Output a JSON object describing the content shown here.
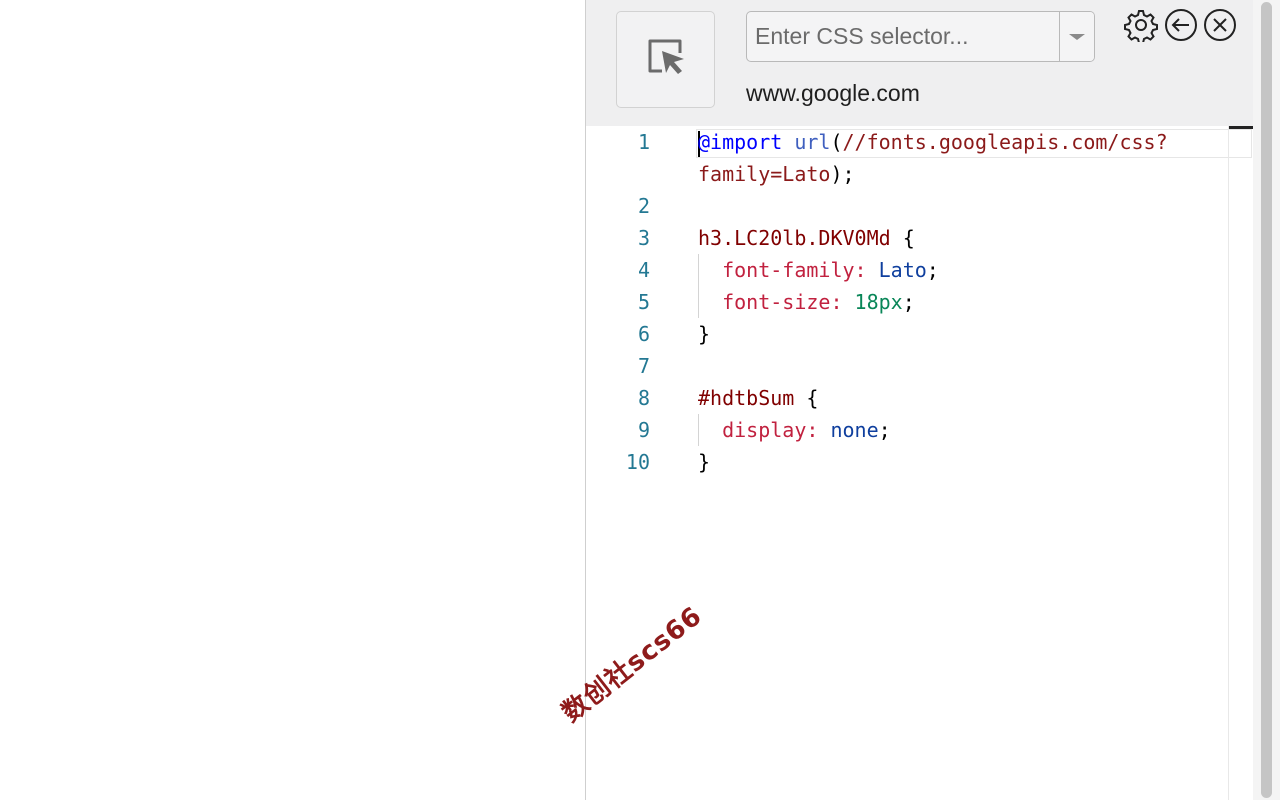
{
  "header": {
    "selector_placeholder": "Enter CSS selector...",
    "domain": "www.google.com",
    "icons": [
      "cursor-select-icon",
      "gear-icon",
      "back-arrow-icon",
      "close-icon"
    ]
  },
  "editor": {
    "lines": [
      {
        "num": "1",
        "tokens": [
          {
            "t": "@import",
            "c": "t-atrule"
          },
          {
            "t": " ",
            "c": "t-plain"
          },
          {
            "t": "url",
            "c": "t-func"
          },
          {
            "t": "(",
            "c": "t-plain"
          },
          {
            "t": "//fonts.googleapis.com/css?",
            "c": "t-url"
          }
        ]
      },
      {
        "num": "",
        "tokens": [
          {
            "t": "family=Lato",
            "c": "t-url"
          },
          {
            "t": ");",
            "c": "t-plain"
          }
        ]
      },
      {
        "num": "2",
        "tokens": []
      },
      {
        "num": "3",
        "tokens": [
          {
            "t": "h3.LC20lb.DKV0Md",
            "c": "t-sel"
          },
          {
            "t": " {",
            "c": "t-plain"
          }
        ]
      },
      {
        "num": "4",
        "tokens": [
          {
            "t": "  font-family:",
            "c": "t-prop"
          },
          {
            "t": " ",
            "c": "t-plain"
          },
          {
            "t": "Lato",
            "c": "t-kw"
          },
          {
            "t": ";",
            "c": "t-plain"
          }
        ]
      },
      {
        "num": "5",
        "tokens": [
          {
            "t": "  font-size:",
            "c": "t-prop"
          },
          {
            "t": " ",
            "c": "t-plain"
          },
          {
            "t": "18px",
            "c": "t-num"
          },
          {
            "t": ";",
            "c": "t-plain"
          }
        ]
      },
      {
        "num": "6",
        "tokens": [
          {
            "t": "}",
            "c": "t-plain"
          }
        ]
      },
      {
        "num": "7",
        "tokens": []
      },
      {
        "num": "8",
        "tokens": [
          {
            "t": "#hdtbSum",
            "c": "t-sel"
          },
          {
            "t": " {",
            "c": "t-plain"
          }
        ]
      },
      {
        "num": "9",
        "tokens": [
          {
            "t": "  display:",
            "c": "t-prop"
          },
          {
            "t": " ",
            "c": "t-plain"
          },
          {
            "t": "none",
            "c": "t-kw"
          },
          {
            "t": ";",
            "c": "t-plain"
          }
        ]
      },
      {
        "num": "10",
        "tokens": [
          {
            "t": "}",
            "c": "t-plain"
          }
        ]
      }
    ]
  },
  "watermark": "数创社scs66",
  "colors": {
    "header_bg": "#efeff0",
    "line_number": "#237893",
    "selector": "#800000",
    "property": "#c1213f",
    "keyword": "#0f3f9e",
    "number": "#098658",
    "at_rule": "#0000ff"
  }
}
